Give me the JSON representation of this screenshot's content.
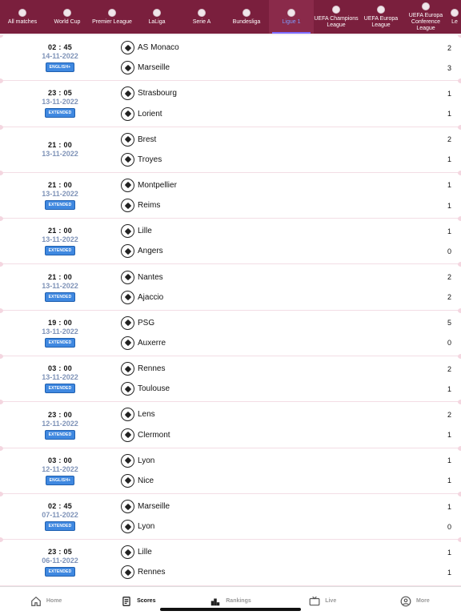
{
  "categories": [
    {
      "label": "All matches",
      "active": false,
      "width": 56
    },
    {
      "label": "World Cup",
      "active": false,
      "width": 56
    },
    {
      "label": "Premier League",
      "active": false,
      "width": 56
    },
    {
      "label": "LaLiga",
      "active": false,
      "width": 56
    },
    {
      "label": "Serie A",
      "active": false,
      "width": 56
    },
    {
      "label": "Bundesliga",
      "active": false,
      "width": 56
    },
    {
      "label": "Ligue 1",
      "active": true,
      "width": 56
    },
    {
      "label": "UEFA Champions League",
      "active": false,
      "width": 56
    },
    {
      "label": "UEFA Europa League",
      "active": false,
      "width": 56
    },
    {
      "label": "UEFA Europa Conference League",
      "active": false,
      "width": 56
    },
    {
      "label": "Le",
      "active": false,
      "width": 16
    }
  ],
  "matches": [
    {
      "time": "02 : 45",
      "date": "14-11-2022",
      "badge": "ENGLISH+",
      "home": "AS Monaco",
      "home_score": "2",
      "away": "Marseille",
      "away_score": "3"
    },
    {
      "time": "23 : 05",
      "date": "13-11-2022",
      "badge": "EXTENDED",
      "home": "Strasbourg",
      "home_score": "1",
      "away": "Lorient",
      "away_score": "1"
    },
    {
      "time": "21 : 00",
      "date": "13-11-2022",
      "badge": "",
      "home": "Brest",
      "home_score": "2",
      "away": "Troyes",
      "away_score": "1"
    },
    {
      "time": "21 : 00",
      "date": "13-11-2022",
      "badge": "EXTENDED",
      "home": "Montpellier",
      "home_score": "1",
      "away": "Reims",
      "away_score": "1"
    },
    {
      "time": "21 : 00",
      "date": "13-11-2022",
      "badge": "EXTENDED",
      "home": "Lille",
      "home_score": "1",
      "away": "Angers",
      "away_score": "0"
    },
    {
      "time": "21 : 00",
      "date": "13-11-2022",
      "badge": "EXTENDED",
      "home": "Nantes",
      "home_score": "2",
      "away": "Ajaccio",
      "away_score": "2"
    },
    {
      "time": "19 : 00",
      "date": "13-11-2022",
      "badge": "EXTENDED",
      "home": "PSG",
      "home_score": "5",
      "away": "Auxerre",
      "away_score": "0"
    },
    {
      "time": "03 : 00",
      "date": "13-11-2022",
      "badge": "EXTENDED",
      "home": "Rennes",
      "home_score": "2",
      "away": "Toulouse",
      "away_score": "1"
    },
    {
      "time": "23 : 00",
      "date": "12-11-2022",
      "badge": "EXTENDED",
      "home": "Lens",
      "home_score": "2",
      "away": "Clermont",
      "away_score": "1"
    },
    {
      "time": "03 : 00",
      "date": "12-11-2022",
      "badge": "ENGLISH+",
      "home": "Lyon",
      "home_score": "1",
      "away": "Nice",
      "away_score": "1"
    },
    {
      "time": "02 : 45",
      "date": "07-11-2022",
      "badge": "EXTENDED",
      "home": "Marseille",
      "home_score": "1",
      "away": "Lyon",
      "away_score": "0"
    },
    {
      "time": "23 : 05",
      "date": "06-11-2022",
      "badge": "EXTENDED",
      "home": "Lille",
      "home_score": "1",
      "away": "Rennes",
      "away_score": "1"
    }
  ],
  "tabbar": {
    "home": "Home",
    "scores": "Scores",
    "rankings": "Rankings",
    "live": "Live",
    "more": "More"
  }
}
